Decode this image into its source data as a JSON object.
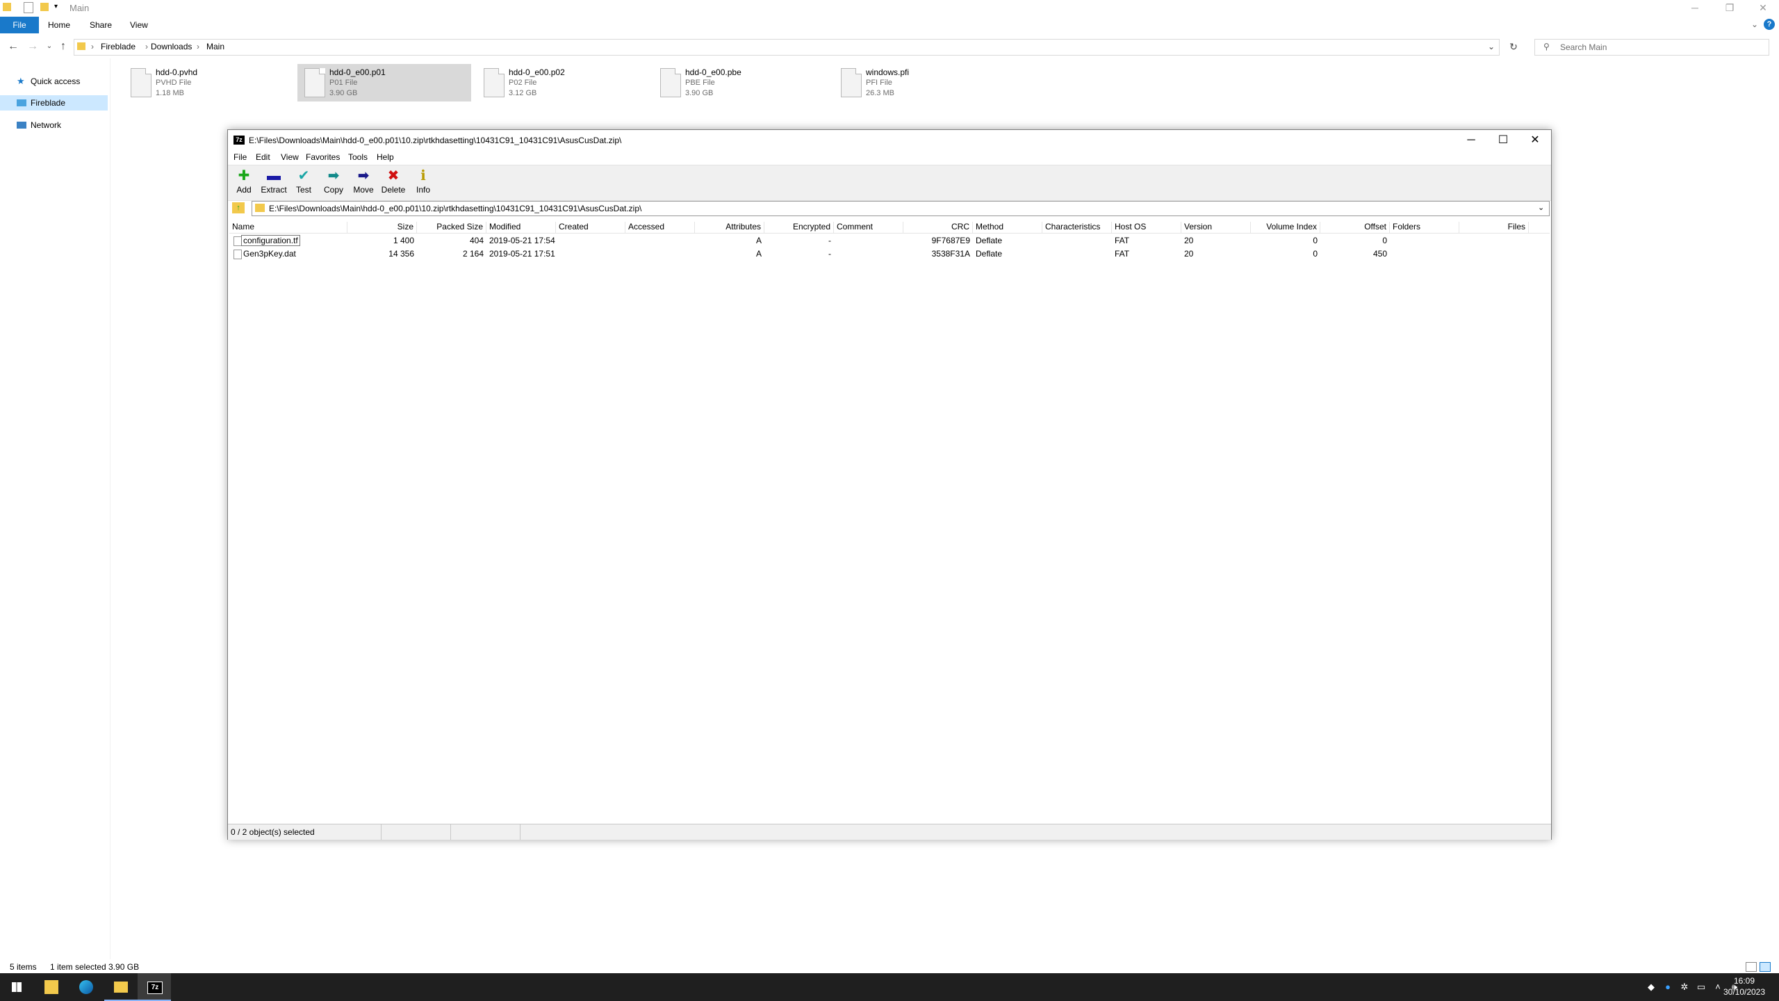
{
  "explorer": {
    "title": "Main",
    "ribbon_tabs": [
      "File",
      "Home",
      "Share",
      "View"
    ],
    "breadcrumb": [
      "Fireblade",
      "Downloads",
      "Main"
    ],
    "search_placeholder": "Search Main",
    "nav_items": [
      "Quick access",
      "Fireblade",
      "Network"
    ],
    "files": [
      {
        "name": "hdd-0.pvhd",
        "type": "PVHD File",
        "size": "1.18 MB"
      },
      {
        "name": "hdd-0_e00.p01",
        "type": "P01 File",
        "size": "3.90 GB"
      },
      {
        "name": "hdd-0_e00.p02",
        "type": "P02 File",
        "size": "3.12 GB"
      },
      {
        "name": "hdd-0_e00.pbe",
        "type": "PBE File",
        "size": "3.90 GB"
      },
      {
        "name": "windows.pfi",
        "type": "PFI File",
        "size": "26.3 MB"
      }
    ],
    "status_items": "5 items",
    "status_selected": "1 item selected  3.90 GB"
  },
  "zip": {
    "title": "E:\\Files\\Downloads\\Main\\hdd-0_e00.p01\\10.zip\\rtkhdasetting\\10431C91_10431C91\\AsusCusDat.zip\\",
    "app_icon_label": "7z",
    "menu": [
      "File",
      "Edit",
      "View",
      "Favorites",
      "Tools",
      "Help"
    ],
    "toolbar": [
      {
        "label": "Add",
        "icon": "plus-icon",
        "glyph": "✚",
        "color": "#1aa61a"
      },
      {
        "label": "Extract",
        "icon": "minus-icon",
        "glyph": "▬",
        "color": "#1a1aa6"
      },
      {
        "label": "Test",
        "icon": "check-icon",
        "glyph": "✔",
        "color": "#1aa6a6"
      },
      {
        "label": "Copy",
        "icon": "copy-arrow-icon",
        "glyph": "➡",
        "color": "#138a8a"
      },
      {
        "label": "Move",
        "icon": "move-arrow-icon",
        "glyph": "➡",
        "color": "#1a1a8a"
      },
      {
        "label": "Delete",
        "icon": "delete-icon",
        "glyph": "✖",
        "color": "#d01010"
      },
      {
        "label": "Info",
        "icon": "info-icon",
        "glyph": "ℹ",
        "color": "#b89a00"
      }
    ],
    "address": "E:\\Files\\Downloads\\Main\\hdd-0_e00.p01\\10.zip\\rtkhdasetting\\10431C91_10431C91\\AsusCusDat.zip\\",
    "columns": [
      "Name",
      "Size",
      "Packed Size",
      "Modified",
      "Created",
      "Accessed",
      "Attributes",
      "Encrypted",
      "Comment",
      "CRC",
      "Method",
      "Characteristics",
      "Host OS",
      "Version",
      "Volume Index",
      "Offset",
      "Folders",
      "Files"
    ],
    "rows": [
      {
        "name": "configuration.tf",
        "size": "1 400",
        "packed": "404",
        "modified": "2019-05-21 17:54",
        "created": "",
        "accessed": "",
        "attributes": "A",
        "encrypted": "-",
        "comment": "",
        "crc": "9F7687E9",
        "method": "Deflate",
        "characteristics": "",
        "host_os": "FAT",
        "version": "20",
        "volume_index": "0",
        "offset": "0",
        "folders": "",
        "files": ""
      },
      {
        "name": "Gen3pKey.dat",
        "size": "14 356",
        "packed": "2 164",
        "modified": "2019-05-21 17:51",
        "created": "",
        "accessed": "",
        "attributes": "A",
        "encrypted": "-",
        "comment": "",
        "crc": "3538F31A",
        "method": "Deflate",
        "characteristics": "",
        "host_os": "FAT",
        "version": "20",
        "volume_index": "0",
        "offset": "450",
        "folders": "",
        "files": ""
      }
    ],
    "status": "0 / 2 object(s) selected"
  },
  "taskbar": {
    "time": "16:09",
    "date": "30/10/2023",
    "zip_label": "7z"
  }
}
